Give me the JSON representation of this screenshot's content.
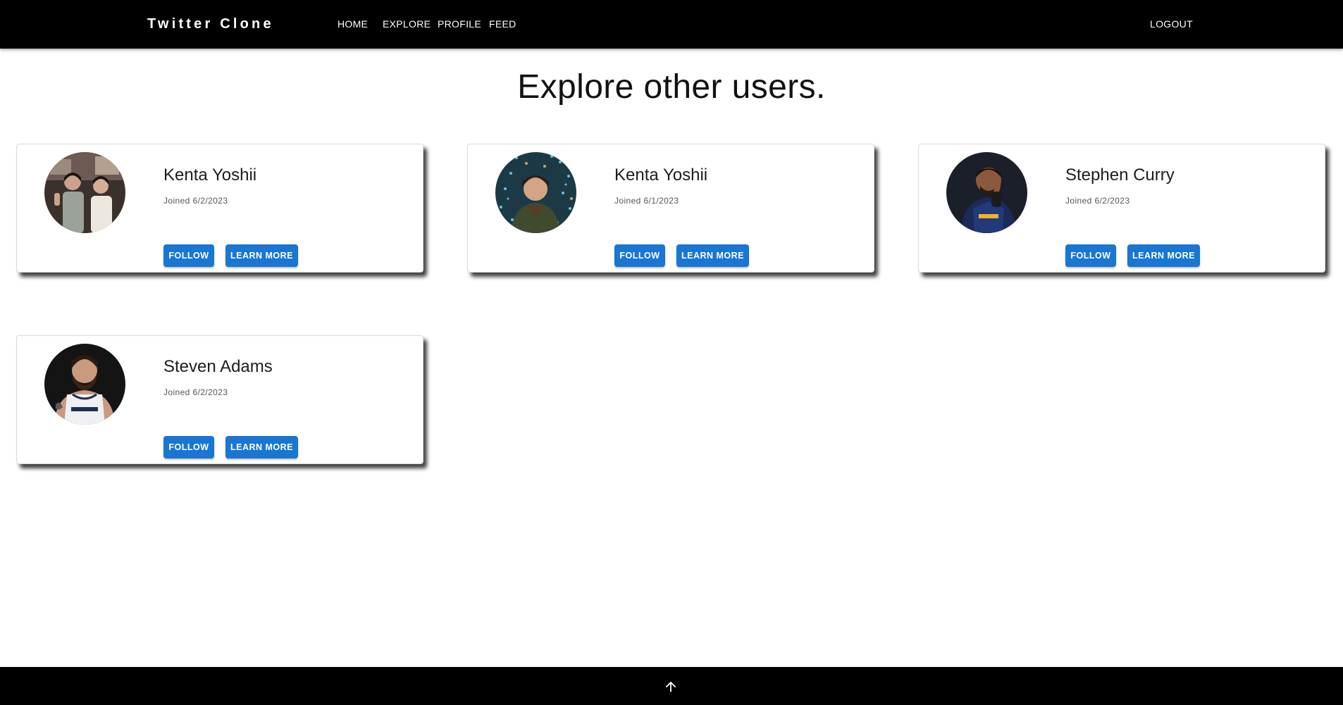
{
  "nav": {
    "brand": "Twitter Clone",
    "home": "HOME",
    "explore": "EXPLORE",
    "profile": "PROFILE",
    "feed": "FEED",
    "logout": "LOGOUT"
  },
  "main": {
    "title": "Explore other users."
  },
  "users": [
    {
      "name": "Kenta Yoshii",
      "joined": "Joined 6/2/2023",
      "follow_label": "FOLLOW",
      "learn_label": "LEARN MORE"
    },
    {
      "name": "Kenta Yoshii",
      "joined": "Joined 6/1/2023",
      "follow_label": "FOLLOW",
      "learn_label": "LEARN MORE"
    },
    {
      "name": "Stephen Curry",
      "joined": "Joined 6/2/2023",
      "follow_label": "FOLLOW",
      "learn_label": "LEARN MORE"
    },
    {
      "name": "Steven Adams",
      "joined": "Joined 6/2/2023",
      "follow_label": "FOLLOW",
      "learn_label": "LEARN MORE"
    }
  ],
  "footer": {
    "scroll_top_icon": "arrow-up-icon"
  },
  "colors": {
    "nav_bg": "#000000",
    "button": "#1976d2",
    "footer_bg": "#000000"
  }
}
